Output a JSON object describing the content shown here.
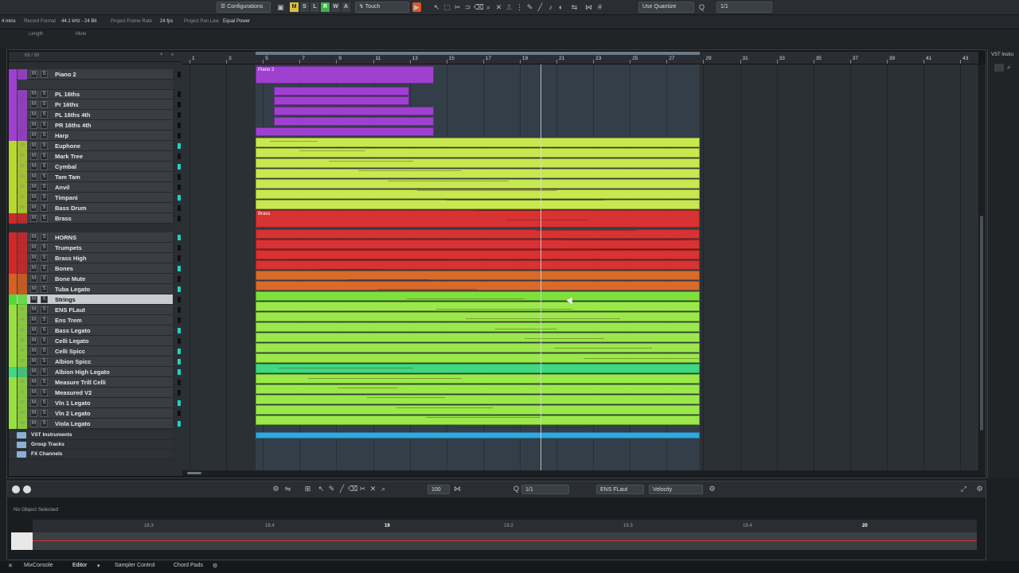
{
  "toolbar": {
    "configurations": "Configurations",
    "modes": [
      "M",
      "S",
      "L",
      "R",
      "W",
      "A"
    ],
    "automation_mode": "Touch",
    "quantize": "Use Quantize",
    "quantize_value": "1/1"
  },
  "infobar": {
    "duration": "4 mins",
    "record_format_label": "Record Format",
    "record_format": "44.1 kHz - 24 Bit",
    "frame_rate_label": "Project Frame Rate",
    "frame_rate": "24 fps",
    "pan_law_label": "Project Pan Law",
    "pan_law": "Equal Power"
  },
  "subinfo": {
    "length_label": "Length",
    "mute_label": "Mute"
  },
  "tracklist": {
    "counter": "68 / 68",
    "tracks": [
      {
        "num": "",
        "name": "Piano 2",
        "color": "#a040d0"
      },
      {
        "num": "",
        "name": "PL 16ths",
        "color": "#a040d0"
      },
      {
        "num": "",
        "name": "Pr 16ths",
        "color": "#a040d0"
      },
      {
        "num": "",
        "name": "PL 16ths 4th",
        "color": "#a040d0"
      },
      {
        "num": "",
        "name": "PR 16ths 4th",
        "color": "#a040d0"
      },
      {
        "num": "",
        "name": "Harp",
        "color": "#a040d0"
      },
      {
        "num": "20",
        "name": "Euphone",
        "color": "#b8d830"
      },
      {
        "num": "21",
        "name": "Mark Tree",
        "color": "#b8d830"
      },
      {
        "num": "22",
        "name": "Cymbal",
        "color": "#b8d830"
      },
      {
        "num": "23",
        "name": "Tam Tam",
        "color": "#b8d830"
      },
      {
        "num": "24",
        "name": "Anvil",
        "color": "#b8d830"
      },
      {
        "num": "25",
        "name": "Timpani",
        "color": "#b8d830"
      },
      {
        "num": "26",
        "name": "Bass Drum",
        "color": "#b8d830"
      },
      {
        "num": "",
        "name": "Brass",
        "color": "#d02828"
      },
      {
        "num": "",
        "name": "HORNS",
        "color": "#d02828"
      },
      {
        "num": "",
        "name": "Trumpets",
        "color": "#d02828"
      },
      {
        "num": "",
        "name": "Brass High",
        "color": "#d02828"
      },
      {
        "num": "",
        "name": "Bones",
        "color": "#d02828"
      },
      {
        "num": "",
        "name": "Bone Mute",
        "color": "#d86020"
      },
      {
        "num": "",
        "name": "Tuba Legato",
        "color": "#d86020"
      },
      {
        "num": "",
        "name": "Strings",
        "color": "#58d838"
      },
      {
        "num": "33",
        "name": "ENS FLaut",
        "color": "#98e040"
      },
      {
        "num": "34",
        "name": "Ens Trem",
        "color": "#98e040"
      },
      {
        "num": "35",
        "name": "Bass Legato",
        "color": "#98e040"
      },
      {
        "num": "36",
        "name": "Celli Legato",
        "color": "#98e040"
      },
      {
        "num": "37",
        "name": "Celli Spicc",
        "color": "#98e040"
      },
      {
        "num": "38",
        "name": "Albion Spicc",
        "color": "#98e040"
      },
      {
        "num": "39",
        "name": "Albion High Legato",
        "color": "#40d880"
      },
      {
        "num": "40",
        "name": "Measure Trill Celli",
        "color": "#98e040"
      },
      {
        "num": "41",
        "name": "Measured V2",
        "color": "#98e040"
      },
      {
        "num": "42",
        "name": "Vln 1 Legato",
        "color": "#98e040"
      },
      {
        "num": "43",
        "name": "Vln 2 Legato",
        "color": "#98e040"
      },
      {
        "num": "44",
        "name": "Viola Legato",
        "color": "#98e040"
      }
    ],
    "folders": [
      "VST Instruments",
      "Group Tracks",
      "FX Channels"
    ]
  },
  "ruler": [
    "1",
    "3",
    "5",
    "7",
    "9",
    "11",
    "13",
    "15",
    "17",
    "19",
    "21",
    "23",
    "25",
    "27",
    "29",
    "31",
    "33",
    "35",
    "37",
    "39",
    "41",
    "43"
  ],
  "clips": {
    "piano_label": "Piano 2",
    "brass_label": "Brass"
  },
  "lowerzone": {
    "status": "No Object Selected",
    "grid_value": "100",
    "quantize": "1/1",
    "track": "ENS FLaut",
    "lane": "Velocity",
    "ruler": [
      "18.3",
      "18.4",
      "19",
      "19.2",
      "19.3",
      "19.4",
      "20"
    ]
  },
  "tabs": [
    "MixConsole",
    "Editor",
    "Sampler Control",
    "Chord Pads"
  ],
  "right_panel_title": "VST Instru",
  "colors": {
    "purple": "#a040d0",
    "lime": "#c8e850",
    "red": "#d83232",
    "orange": "#d86a2a",
    "green": "#9ae84a",
    "teal_green": "#40d880",
    "blue": "#30a8e0"
  }
}
